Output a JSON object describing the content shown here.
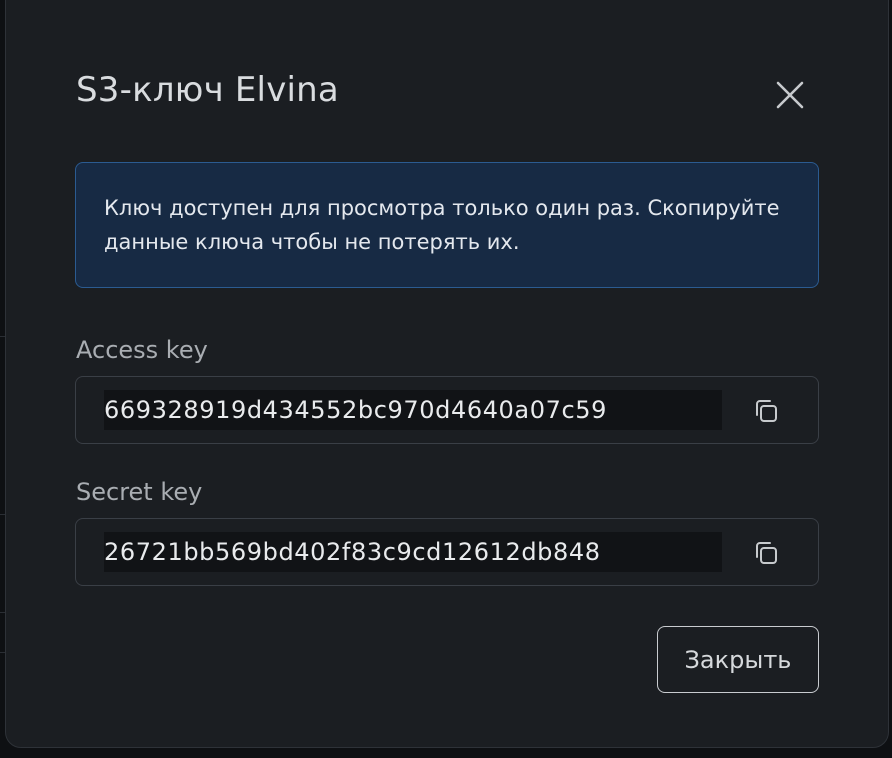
{
  "dialog": {
    "title": "S3-ключ Elvina",
    "info_message": "Ключ доступен для просмотра только один раз. Скопируйте данные ключа чтобы не потерять их.",
    "access_key": {
      "label": "Access key",
      "value": "669328919d434552bc970d4640a07c59",
      "copy_icon": "copy-icon"
    },
    "secret_key": {
      "label": "Secret key",
      "value": "26721bb569bd402f83c9cd12612db848",
      "copy_icon": "copy-icon"
    },
    "close_button_label": "Закрыть",
    "close_icon": "close-icon"
  },
  "colors": {
    "modal_bg": "#1b1e22",
    "info_bg": "#172a44",
    "info_border": "#2b5b91",
    "text_primary": "#d9dcdf",
    "text_label": "#a9adb2"
  }
}
